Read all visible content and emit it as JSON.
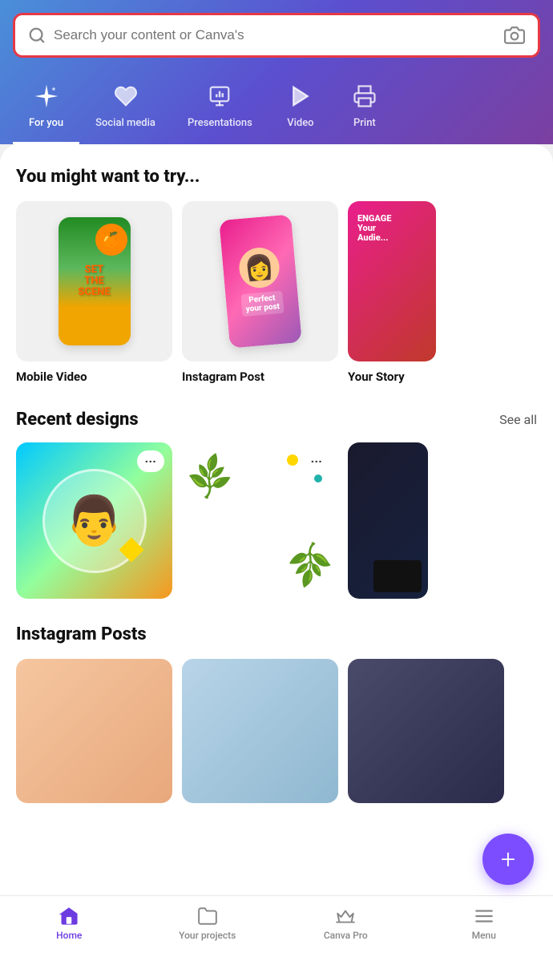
{
  "header": {
    "search_placeholder": "Search your content or Canva's",
    "gradient_start": "#4a90d9",
    "gradient_end": "#7b3fa0"
  },
  "nav_tabs": [
    {
      "id": "for-you",
      "label": "For you",
      "icon": "sparkle",
      "active": true
    },
    {
      "id": "social-media",
      "label": "Social media",
      "icon": "heart",
      "active": false
    },
    {
      "id": "presentations",
      "label": "Presentations",
      "icon": "pie-chart",
      "active": false
    },
    {
      "id": "video",
      "label": "Video",
      "icon": "play",
      "active": false
    },
    {
      "id": "print",
      "label": "Print",
      "icon": "print",
      "active": false
    }
  ],
  "try_section": {
    "title": "You might want to try...",
    "cards": [
      {
        "id": "mobile-video",
        "label": "Mobile Video"
      },
      {
        "id": "instagram-post",
        "label": "Instagram Post"
      },
      {
        "id": "your-story",
        "label": "Your Story"
      }
    ]
  },
  "recent_designs": {
    "title": "Recent designs",
    "see_all_label": "See all",
    "cards": [
      {
        "id": "design-1",
        "type": "portrait-gradient"
      },
      {
        "id": "design-2",
        "type": "floral-white"
      },
      {
        "id": "design-3",
        "type": "dark-partial"
      }
    ],
    "more_button_label": "···"
  },
  "instagram_posts": {
    "title": "Instagram Posts",
    "cards": [
      {
        "id": "ig-1",
        "type": "warm"
      },
      {
        "id": "ig-2",
        "type": "cool"
      },
      {
        "id": "ig-3",
        "type": "dark"
      }
    ]
  },
  "fab": {
    "label": "+"
  },
  "bottom_nav": [
    {
      "id": "home",
      "label": "Home",
      "icon": "home",
      "active": true
    },
    {
      "id": "projects",
      "label": "Your projects",
      "icon": "folder",
      "active": false
    },
    {
      "id": "canva-pro",
      "label": "Canva Pro",
      "icon": "crown",
      "active": false
    },
    {
      "id": "menu",
      "label": "Menu",
      "icon": "menu",
      "active": false
    }
  ]
}
